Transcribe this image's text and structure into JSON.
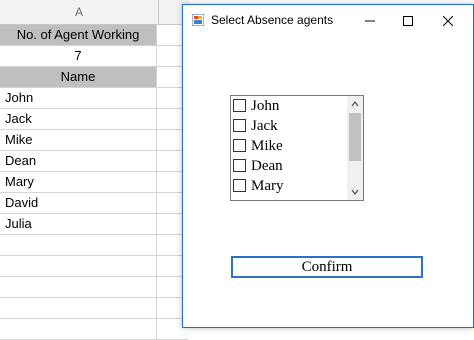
{
  "sheet": {
    "column_header": "A",
    "rows": [
      {
        "text": "No. of Agent Working",
        "style": "header"
      },
      {
        "text": "7",
        "style": "center"
      },
      {
        "text": "Name",
        "style": "header"
      },
      {
        "text": "John",
        "style": "left"
      },
      {
        "text": "Jack",
        "style": "left"
      },
      {
        "text": "Mike",
        "style": "left"
      },
      {
        "text": "Dean",
        "style": "left"
      },
      {
        "text": "Mary",
        "style": "left"
      },
      {
        "text": "David",
        "style": "left"
      },
      {
        "text": "Julia",
        "style": "left"
      },
      {
        "text": "",
        "style": "left"
      },
      {
        "text": "",
        "style": "left"
      },
      {
        "text": "",
        "style": "left"
      },
      {
        "text": "",
        "style": "left"
      },
      {
        "text": "",
        "style": "left"
      }
    ]
  },
  "dialog": {
    "title": "Select Absence agents",
    "minimize_icon": "minimize-icon",
    "maximize_icon": "maximize-icon",
    "close_icon": "close-icon",
    "list_items": [
      {
        "label": "John",
        "checked": false
      },
      {
        "label": "Jack",
        "checked": false
      },
      {
        "label": "Mike",
        "checked": false
      },
      {
        "label": "Dean",
        "checked": false
      },
      {
        "label": "Mary",
        "checked": false
      }
    ],
    "confirm_label": "Confirm"
  },
  "colors": {
    "header_fill": "#bfbfbf",
    "dialog_border": "#1f6fc5",
    "button_border": "#2a73c9"
  }
}
